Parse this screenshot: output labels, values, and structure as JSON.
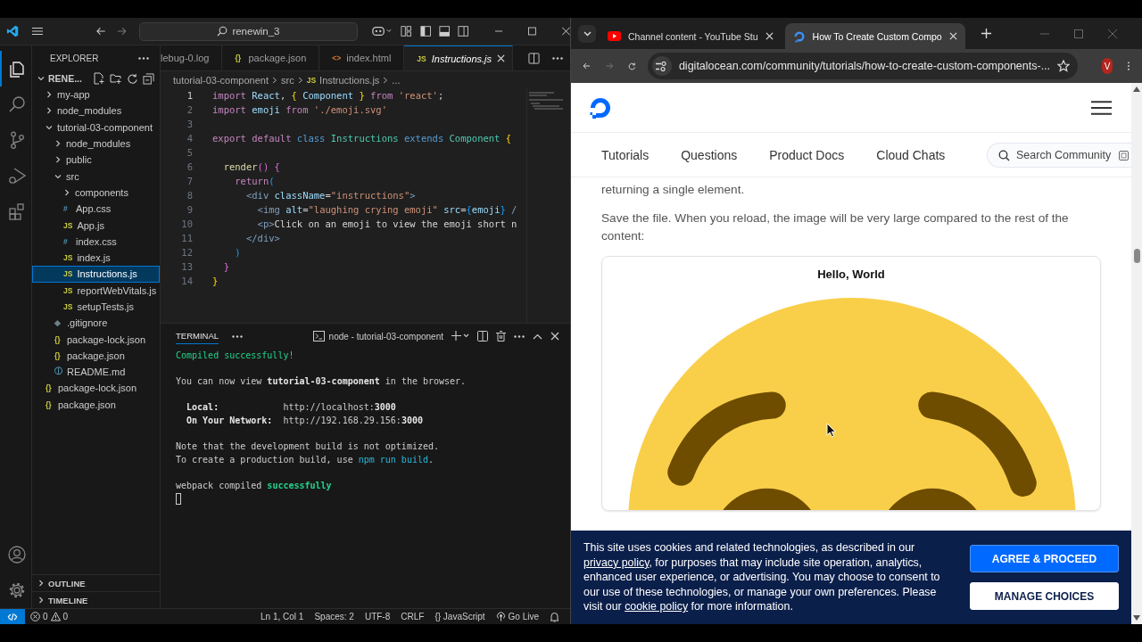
{
  "vscode": {
    "title_bar": {
      "search": "renewin_3"
    },
    "activity_bar": [
      {
        "kind": "explorer",
        "selected": true
      },
      {
        "kind": "search",
        "selected": false
      },
      {
        "kind": "source-control",
        "selected": false
      },
      {
        "kind": "run-debug",
        "selected": false
      },
      {
        "kind": "extensions",
        "selected": false
      }
    ],
    "explorer": {
      "title": "EXPLORER",
      "root": {
        "label": "RENE...",
        "expanded": true,
        "children": [
          {
            "label": "my-app",
            "kind": "folder",
            "expanded": false,
            "selected": false
          },
          {
            "label": "node_modules",
            "kind": "folder",
            "expanded": false,
            "selected": false
          },
          {
            "label": "tutorial-03-component",
            "kind": "folder",
            "expanded": true,
            "selected": false,
            "children": [
              {
                "label": "node_modules",
                "kind": "folder",
                "expanded": false,
                "selected": false
              },
              {
                "label": "public",
                "kind": "folder",
                "expanded": false,
                "selected": false
              },
              {
                "label": "src",
                "kind": "folder",
                "expanded": true,
                "selected": false,
                "children": [
                  {
                    "label": "components",
                    "kind": "folder",
                    "expanded": false,
                    "selected": false
                  },
                  {
                    "label": "App.css",
                    "kind": "css",
                    "icon": "#",
                    "selected": false
                  },
                  {
                    "label": "App.js",
                    "kind": "js",
                    "icon": "JS",
                    "selected": false
                  },
                  {
                    "label": "index.css",
                    "kind": "css",
                    "icon": "#",
                    "selected": false
                  },
                  {
                    "label": "index.js",
                    "kind": "js",
                    "icon": "JS",
                    "selected": false
                  },
                  {
                    "label": "Instructions.js",
                    "kind": "js",
                    "icon": "JS",
                    "selected": true
                  },
                  {
                    "label": "reportWebVitals.js",
                    "kind": "js",
                    "icon": "JS",
                    "selected": false
                  },
                  {
                    "label": "setupTests.js",
                    "kind": "js",
                    "icon": "JS",
                    "selected": false
                  }
                ]
              },
              {
                "label": ".gitignore",
                "kind": "git",
                "icon": "◆",
                "selected": false
              },
              {
                "label": "package-lock.json",
                "kind": "json",
                "icon": "{}",
                "selected": false
              },
              {
                "label": "package.json",
                "kind": "json",
                "icon": "{}",
                "selected": false
              },
              {
                "label": "README.md",
                "kind": "info",
                "icon": "ⓘ",
                "selected": false
              }
            ]
          },
          {
            "label": "package-lock.json",
            "kind": "json",
            "icon": "{}",
            "selected": false
          },
          {
            "label": "package.json",
            "kind": "json",
            "icon": "{}",
            "selected": false
          }
        ]
      },
      "sections": [
        {
          "label": "OUTLINE",
          "expanded": false
        },
        {
          "label": "TIMELINE",
          "expanded": false
        }
      ]
    },
    "editor_tabs": [
      {
        "label": "lebug-0.log",
        "selected": false
      },
      {
        "label": "package.json",
        "kind": "json",
        "icon": "{}",
        "selected": false
      },
      {
        "label": "index.html",
        "kind": "html",
        "icon": "<>",
        "selected": false
      },
      {
        "label": "Instructions.js",
        "kind": "js",
        "icon": "JS",
        "selected": true
      }
    ],
    "breadcrumb": [
      {
        "label": "tutorial-03-component"
      },
      {
        "label": "src"
      },
      {
        "label": "Instructions.js",
        "kind": "js",
        "icon": "JS"
      },
      {
        "label": "..."
      }
    ],
    "code": [
      {
        "number": "1",
        "current": true,
        "tokens": [
          {
            "text": "import",
            "kind": "kw"
          },
          {
            "text": " React",
            "kind": "var"
          },
          {
            "text": ", ",
            "kind": "plain"
          },
          {
            "text": "{",
            "kind": "b1"
          },
          {
            "text": " Component ",
            "kind": "var"
          },
          {
            "text": "}",
            "kind": "b1"
          },
          {
            "text": " from",
            "kind": "kw"
          },
          {
            "text": " 'react'",
            "kind": "str"
          },
          {
            "text": ";",
            "kind": "plain"
          }
        ]
      },
      {
        "number": "2",
        "current": false,
        "tokens": [
          {
            "text": "import",
            "kind": "kw"
          },
          {
            "text": " emoji",
            "kind": "var"
          },
          {
            "text": " from",
            "kind": "kw"
          },
          {
            "text": " './emoji.svg'",
            "kind": "str"
          }
        ]
      },
      {
        "number": "3",
        "current": false
      },
      {
        "number": "4",
        "current": false,
        "tokens": [
          {
            "text": "export default",
            "kind": "kw"
          },
          {
            "text": " class",
            "kind": "storage"
          },
          {
            "text": " Instructions",
            "kind": "cls"
          },
          {
            "text": " extends",
            "kind": "storage"
          },
          {
            "text": " Component",
            "kind": "cls"
          },
          {
            "text": " {",
            "kind": "b1"
          }
        ]
      },
      {
        "number": "5",
        "current": false
      },
      {
        "number": "6",
        "current": false,
        "tokens": [
          {
            "text": "  render",
            "kind": "func"
          },
          {
            "text": "()",
            "kind": "b2"
          },
          {
            "text": " {",
            "kind": "b2"
          }
        ]
      },
      {
        "number": "7",
        "current": false,
        "tokens": [
          {
            "text": "    return",
            "kind": "kw"
          },
          {
            "text": "(",
            "kind": "b3"
          }
        ]
      },
      {
        "number": "8",
        "current": false,
        "tokens": [
          {
            "text": "      <div",
            "kind": "tag"
          },
          {
            "text": " className",
            "kind": "var"
          },
          {
            "text": "=",
            "kind": "plain"
          },
          {
            "text": "\"instructions\"",
            "kind": "str"
          },
          {
            "text": ">",
            "kind": "tag"
          }
        ]
      },
      {
        "number": "9",
        "current": false,
        "tokens": [
          {
            "text": "        <img",
            "kind": "tag"
          },
          {
            "text": " alt",
            "kind": "var"
          },
          {
            "text": "=",
            "kind": "plain"
          },
          {
            "text": "\"laughing crying emoji\"",
            "kind": "str"
          },
          {
            "text": " src",
            "kind": "var"
          },
          {
            "text": "=",
            "kind": "plain"
          },
          {
            "text": "{",
            "kind": "b3"
          },
          {
            "text": "emoji",
            "kind": "var"
          },
          {
            "text": "}",
            "kind": "b3"
          },
          {
            "text": " /",
            "kind": "tag"
          }
        ]
      },
      {
        "number": "10",
        "current": false,
        "tokens": [
          {
            "text": "        <p>",
            "kind": "tag"
          },
          {
            "text": "Click on an emoji to view the emoji short n",
            "kind": "plain"
          }
        ]
      },
      {
        "number": "11",
        "current": false,
        "tokens": [
          {
            "text": "      </div>",
            "kind": "tag"
          }
        ]
      },
      {
        "number": "12",
        "current": false,
        "tokens": [
          {
            "text": "    )",
            "kind": "b3"
          }
        ]
      },
      {
        "number": "13",
        "current": false,
        "tokens": [
          {
            "text": "  }",
            "kind": "b2"
          }
        ]
      },
      {
        "number": "14",
        "current": false,
        "tokens": [
          {
            "text": "}",
            "kind": "b1"
          }
        ]
      }
    ],
    "terminal": {
      "tab": "TERMINAL",
      "process": "node - tutorial-03-component",
      "blocks": [
        [
          {
            "tokens": [
              {
                "text": "Compiled successfully!",
                "kind": "success"
              }
            ]
          }
        ],
        [
          {
            "tokens": [
              {
                "text": "You can now view ",
                "kind": "plain"
              },
              {
                "text": "tutorial-03-component",
                "kind": "bold"
              },
              {
                "text": " in the browser.",
                "kind": "plain"
              }
            ]
          }
        ],
        [
          {
            "tokens": [
              {
                "text": "  Local:",
                "kind": "bold"
              },
              {
                "text": "            http://localhost:",
                "kind": "plain"
              },
              {
                "text": "3000",
                "kind": "bold"
              }
            ]
          },
          {
            "tokens": [
              {
                "text": "  On Your Network:",
                "kind": "bold"
              },
              {
                "text": "  http://192.168.29.156:",
                "kind": "plain"
              },
              {
                "text": "3000",
                "kind": "bold"
              }
            ]
          }
        ],
        [
          {
            "tokens": [
              {
                "text": "Note that the development build is not optimized.",
                "kind": "plain"
              }
            ]
          },
          {
            "tokens": [
              {
                "text": "To create a production build, use ",
                "kind": "plain"
              },
              {
                "text": "npm run build",
                "kind": "link"
              },
              {
                "text": ".",
                "kind": "plain"
              }
            ]
          }
        ],
        [
          {
            "tokens": [
              {
                "text": "webpack compiled ",
                "kind": "plain"
              },
              {
                "text": "successfully",
                "kind": "success-bold"
              }
            ]
          }
        ]
      ]
    },
    "status_bar": {
      "errors": "0",
      "warnings": "0",
      "items": [
        {
          "text": "Ln 1, Col 1",
          "kind": "plain"
        },
        {
          "text": "Spaces: 2",
          "kind": "plain"
        },
        {
          "text": "UTF-8",
          "kind": "plain"
        },
        {
          "text": "CRLF",
          "kind": "plain"
        },
        {
          "text": "{} JavaScript",
          "kind": "plain"
        },
        {
          "text": "Go Live",
          "kind": "live"
        }
      ]
    }
  },
  "browser": {
    "tabs": [
      {
        "title": "Channel content - YouTube Stu",
        "kind": "youtube",
        "selected": false
      },
      {
        "title": "How To Create Custom Compo",
        "kind": "site",
        "selected": true
      }
    ],
    "url": "digitalocean.com/community/tutorials/how-to-create-custom-components-...",
    "profile": "V",
    "nav": [
      "Tutorials",
      "Questions",
      "Product Docs",
      "Cloud Chats"
    ],
    "search": {
      "placeholder": "Search Community"
    },
    "article": {
      "paragraphs": [
        "returning a single element.",
        "Save the file. When you reload, the image will be very large compared to the rest of the content:"
      ],
      "figure": {
        "caption": "Hello, World"
      }
    },
    "cookie_banner": {
      "parts": [
        {
          "text": "This site uses cookies and related technologies, as described in our ",
          "kind": "text"
        },
        {
          "text": "privacy policy",
          "kind": "link"
        },
        {
          "text": ", for purposes that may include site operation, analytics, enhanced user experience, or advertising. You may choose to consent to our use of these technologies, or manage your own preferences. Please visit our ",
          "kind": "text"
        },
        {
          "text": "cookie policy",
          "kind": "link"
        },
        {
          "text": " for more information.",
          "kind": "text"
        }
      ],
      "buttons": [
        {
          "label": "AGREE & PROCEED",
          "kind": "primary"
        },
        {
          "label": "MANAGE CHOICES",
          "kind": "secondary"
        }
      ]
    }
  }
}
